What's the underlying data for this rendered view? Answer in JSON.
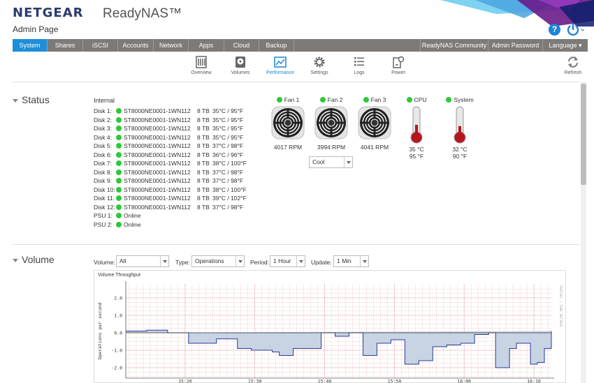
{
  "header": {
    "brand": "NETGEAR",
    "product": "ReadyNAS™",
    "subtitle": "Admin Page",
    "help_icon": "question-circle-icon",
    "power_icon": "power-icon"
  },
  "topnav": {
    "left": [
      {
        "label": "System",
        "active": true
      },
      {
        "label": "Shares"
      },
      {
        "label": "iSCSI"
      },
      {
        "label": "Accounts"
      },
      {
        "label": "Network"
      },
      {
        "label": "Apps"
      },
      {
        "label": "Cloud"
      },
      {
        "label": "Backup"
      }
    ],
    "right": [
      {
        "label": "ReadyNAS Community"
      },
      {
        "label": "Admin Password"
      },
      {
        "label": "Language ▾"
      }
    ]
  },
  "subnav": [
    {
      "label": "Overview",
      "icon": "overview-icon"
    },
    {
      "label": "Volumes",
      "icon": "volumes-icon"
    },
    {
      "label": "Performance",
      "icon": "performance-icon",
      "active": true
    },
    {
      "label": "Settings",
      "icon": "gear-icon"
    },
    {
      "label": "Logs",
      "icon": "logs-icon"
    },
    {
      "label": "Power",
      "icon": "power-settings-icon"
    }
  ],
  "refresh_label": "Refresh",
  "status": {
    "title": "Status",
    "internal_label": "Internal",
    "disks": [
      {
        "label": "Disk 1:",
        "model": "ST8000NE0001-1WN112",
        "capacity": "8 TB",
        "temp": "35°C / 95°F"
      },
      {
        "label": "Disk 2:",
        "model": "ST8000NE0001-1WN112",
        "capacity": "8 TB",
        "temp": "35°C / 95°F"
      },
      {
        "label": "Disk 3:",
        "model": "ST8000NE0001-1WN112",
        "capacity": "8 TB",
        "temp": "35°C / 95°F"
      },
      {
        "label": "Disk 4:",
        "model": "ST8000NE0001-1WN112",
        "capacity": "8 TB",
        "temp": "35°C / 95°F"
      },
      {
        "label": "Disk 5:",
        "model": "ST8000NE0001-1WN112",
        "capacity": "8 TB",
        "temp": "37°C / 98°F"
      },
      {
        "label": "Disk 6:",
        "model": "ST8000NE0001-1WN112",
        "capacity": "8 TB",
        "temp": "36°C / 96°F"
      },
      {
        "label": "Disk 7:",
        "model": "ST8000NE0001-1WN112",
        "capacity": "8 TB",
        "temp": "38°C / 100°F"
      },
      {
        "label": "Disk 8:",
        "model": "ST8000NE0001-1WN112",
        "capacity": "8 TB",
        "temp": "37°C / 98°F"
      },
      {
        "label": "Disk 9:",
        "model": "ST8000NE0001-1WN112",
        "capacity": "8 TB",
        "temp": "37°C / 98°F"
      },
      {
        "label": "Disk 10:",
        "model": "ST8000NE0001-1WN112",
        "capacity": "8 TB",
        "temp": "38°C / 100°F"
      },
      {
        "label": "Disk 11:",
        "model": "ST8000NE0001-1WN112",
        "capacity": "8 TB",
        "temp": "39°C / 102°F"
      },
      {
        "label": "Disk 12:",
        "model": "ST8000NE0001-1WN112",
        "capacity": "8 TB",
        "temp": "37°C / 98°F"
      }
    ],
    "psus": [
      {
        "label": "PSU 1:",
        "state": "Online"
      },
      {
        "label": "PSU 2:",
        "state": "Online"
      }
    ],
    "fans": [
      {
        "name": "Fan 1",
        "rpm": "4017 RPM"
      },
      {
        "name": "Fan 2",
        "rpm": "3994 RPM"
      },
      {
        "name": "Fan 3",
        "rpm": "4041 RPM"
      }
    ],
    "fan_mode": "Cool",
    "sensors": [
      {
        "name": "CPU",
        "c": "35 °C",
        "f": "95 °F",
        "level": 0.45
      },
      {
        "name": "System",
        "c": "32 °C",
        "f": "90 °F",
        "level": 0.4
      }
    ],
    "status_color": "#2dc937"
  },
  "volume": {
    "title": "Volume",
    "filters": {
      "volume_label": "Volume:",
      "volume_value": "All",
      "type_label": "Type:",
      "type_value": "Operations",
      "period_label": "Period:",
      "period_value": "1 Hour",
      "update_label": "Update:",
      "update_value": "1 Min"
    },
    "chart_title": "Volume Throughput"
  },
  "chart_data": {
    "type": "area",
    "title": "Volume Throughput",
    "ylabel": "Operations per second",
    "right_label": "RRDTOOL / TOBI OETIKER",
    "ylim": [
      -2.6,
      2.8
    ],
    "yticks": [
      2.0,
      1.0,
      0.0,
      -1.0,
      -2.0
    ],
    "ytick_labels": [
      "2.0",
      "1.0",
      "0.0",
      "-1.0",
      "-2.0"
    ],
    "xlim_minutes": [
      11.5,
      72.5
    ],
    "xticks_minutes": [
      20,
      30,
      40,
      50,
      60,
      70
    ],
    "xtick_labels": [
      "15:20",
      "15:30",
      "15:40",
      "15:50",
      "16:00",
      "16:10"
    ],
    "fill_color": "#c8d3e3",
    "line_color": "#2a3c9a",
    "steps_x_minutes": [
      11.5,
      13.5,
      14.5,
      15.5,
      17.5,
      19.5,
      20.5,
      22.5,
      24.5,
      26.5,
      27.5,
      28.5,
      29.5,
      31.5,
      32.5,
      33.5,
      35.5,
      37.5,
      39.5,
      41.5,
      43.5,
      45.5,
      47.5,
      49.5,
      51.5,
      53.5,
      55.5,
      57.5,
      59.5,
      61.5,
      63.5,
      64.5,
      66.5,
      67.5,
      69.5,
      70.5,
      71.5,
      72.5
    ],
    "steps_y": [
      0.1,
      0.1,
      0.15,
      0.15,
      0.0,
      0.0,
      -0.6,
      -0.6,
      -0.35,
      -0.35,
      -0.9,
      -0.9,
      -1.0,
      -1.0,
      -1.1,
      -1.3,
      -0.9,
      -0.9,
      0.0,
      -0.2,
      0.0,
      -1.3,
      -0.6,
      -0.4,
      -1.8,
      -1.6,
      -0.8,
      -0.7,
      -0.6,
      -0.1,
      0.0,
      -2.0,
      -0.9,
      -0.6,
      -1.8,
      -1.7,
      -0.9,
      0.1
    ]
  }
}
